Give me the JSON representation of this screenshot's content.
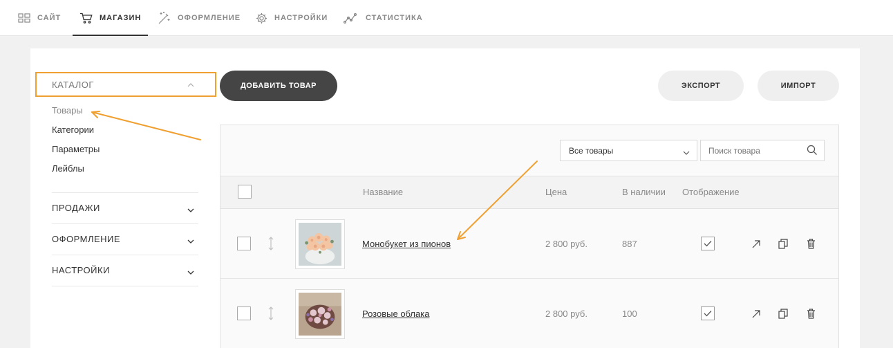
{
  "topnav": {
    "items": [
      {
        "label": "САЙТ",
        "icon": "grid-icon"
      },
      {
        "label": "МАГАЗИН",
        "icon": "cart-icon",
        "active": true
      },
      {
        "label": "ОФОРМЛЕНИЕ",
        "icon": "magic-wand-icon"
      },
      {
        "label": "НАСТРОЙКИ",
        "icon": "gear-icon"
      },
      {
        "label": "СТАТИСТИКА",
        "icon": "chart-line-icon"
      }
    ]
  },
  "sidebar": {
    "catalog_label": "КАТАЛОГ",
    "catalog_items": [
      "Товары",
      "Категории",
      "Параметры",
      "Лейблы"
    ],
    "sections": [
      "ПРОДАЖИ",
      "ОФОРМЛЕНИЕ",
      "НАСТРОЙКИ"
    ]
  },
  "toolbar": {
    "add_label": "ДОБАВИТЬ ТОВАР",
    "export_label": "ЭКСПОРТ",
    "import_label": "ИМПОРТ"
  },
  "filters": {
    "select_value": "Все товары",
    "search_placeholder": "Поиск товара"
  },
  "table": {
    "headers": {
      "name": "Название",
      "price": "Цена",
      "stock": "В наличии",
      "display": "Отображение"
    },
    "rows": [
      {
        "name": "Монобукет из пионов",
        "price": "2 800 руб.",
        "stock": "887",
        "display": true
      },
      {
        "name": "Розовые облака",
        "price": "2 800 руб.",
        "stock": "100",
        "display": true
      }
    ]
  },
  "colors": {
    "accent": "#f0a030",
    "dark_button": "#454545"
  }
}
